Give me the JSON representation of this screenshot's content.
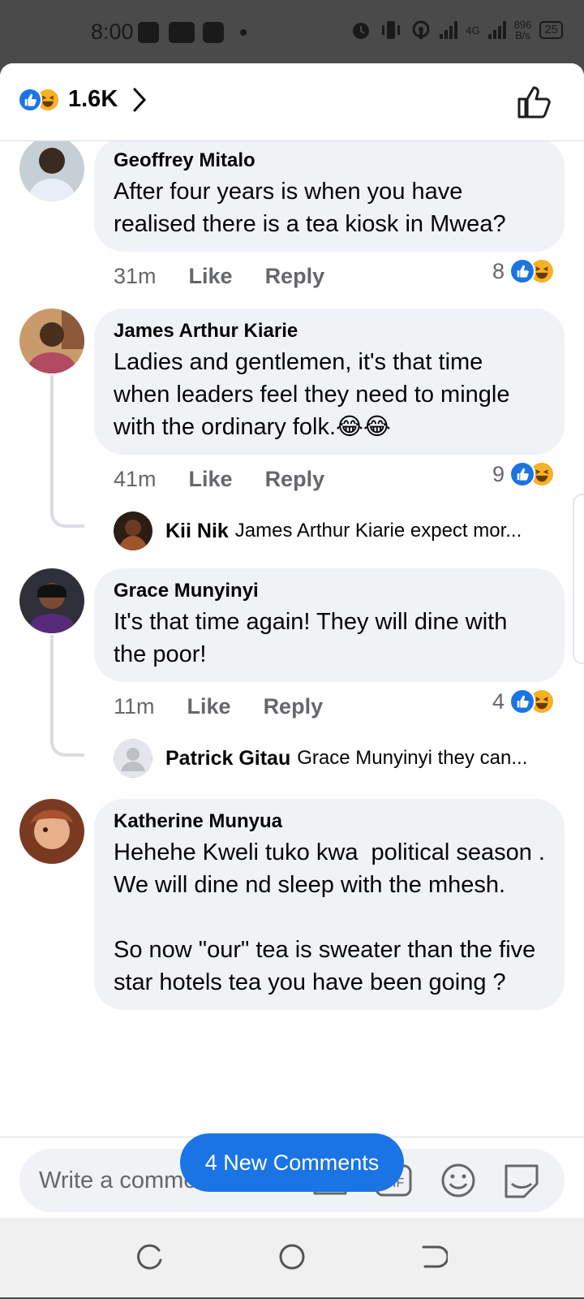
{
  "status_bar": {
    "time": "8:00",
    "network_speed": "896",
    "network_unit": "B/s",
    "network_type": "4G",
    "battery": "25"
  },
  "header": {
    "reaction_count": "1.6K",
    "reactions": [
      "like",
      "haha"
    ]
  },
  "comments": [
    {
      "author": "Geoffrey Mitalo",
      "text": "After four years is when you have realised there is a tea kiosk in Mwea?",
      "time": "31m",
      "like_label": "Like",
      "reply_label": "Reply",
      "reaction_count": "8"
    },
    {
      "author": "James Arthur Kiarie",
      "text": "Ladies and gentlemen, it's that time when leaders feel they need to mingle with the ordinary folk.😂😂",
      "time": "41m",
      "like_label": "Like",
      "reply_label": "Reply",
      "reaction_count": "9",
      "reply_preview": {
        "author": "Kii Nik",
        "text": "James Arthur Kiarie expect mor..."
      }
    },
    {
      "author": "Grace Munyinyi",
      "text": "It's that time again! They will dine with the poor!",
      "time": "11m",
      "like_label": "Like",
      "reply_label": "Reply",
      "reaction_count": "4",
      "reply_preview": {
        "author": "Patrick Gitau",
        "text": "Grace Munyinyi they can..."
      }
    },
    {
      "author": "Katherine Munyua",
      "text": "Hehehe Kweli tuko kwa  political season .\nWe will dine nd sleep with the mhesh.\n\nSo now \"our\" tea is sweater than the five star hotels tea you have been going ?"
    }
  ],
  "new_comments_label": "4 New Comments",
  "composer": {
    "placeholder": "Write a comment...",
    "icons": [
      "camera-icon",
      "gif-icon",
      "emoji-icon",
      "sticker-icon"
    ]
  },
  "colors": {
    "accent": "#1b74e4",
    "bubble": "#f0f2f5",
    "secondary_text": "#65676b"
  }
}
